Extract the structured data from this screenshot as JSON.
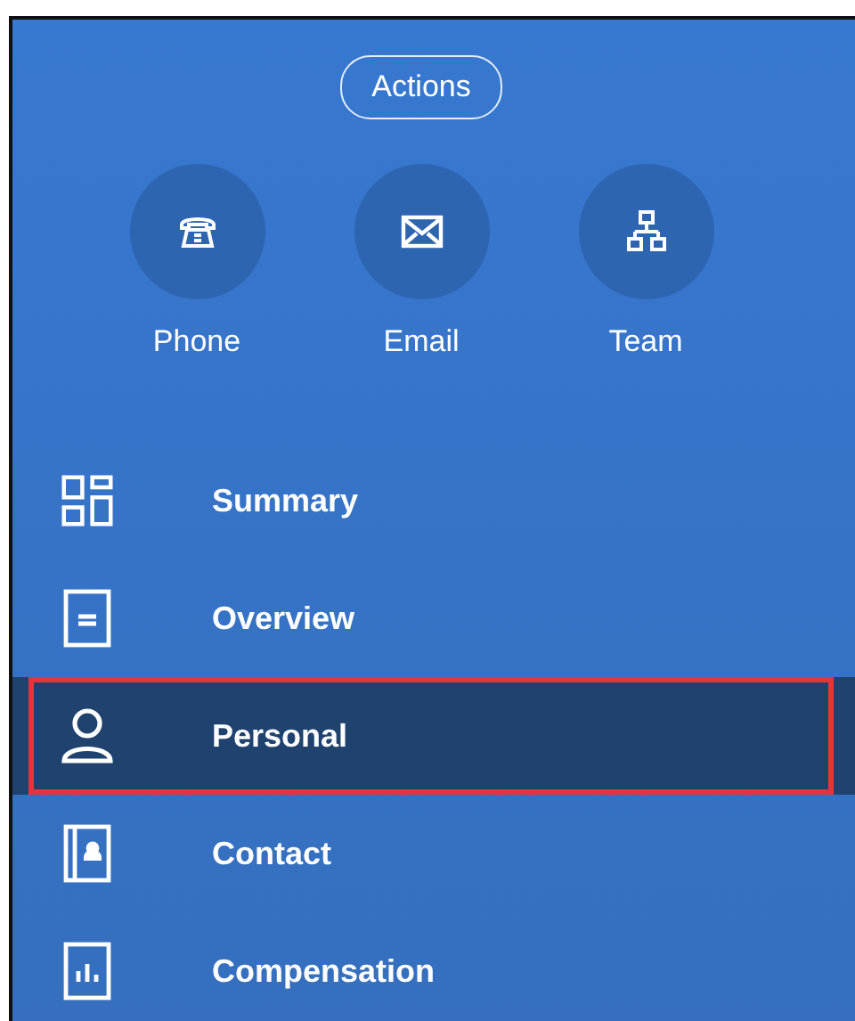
{
  "actions_button": {
    "label": "Actions"
  },
  "quick_actions": [
    {
      "label": "Phone"
    },
    {
      "label": "Email"
    },
    {
      "label": "Team"
    }
  ],
  "menu": [
    {
      "label": "Summary",
      "selected": false,
      "highlighted": false
    },
    {
      "label": "Overview",
      "selected": false,
      "highlighted": false
    },
    {
      "label": "Personal",
      "selected": true,
      "highlighted": true
    },
    {
      "label": "Contact",
      "selected": false,
      "highlighted": false
    },
    {
      "label": "Compensation",
      "selected": false,
      "highlighted": false
    }
  ]
}
